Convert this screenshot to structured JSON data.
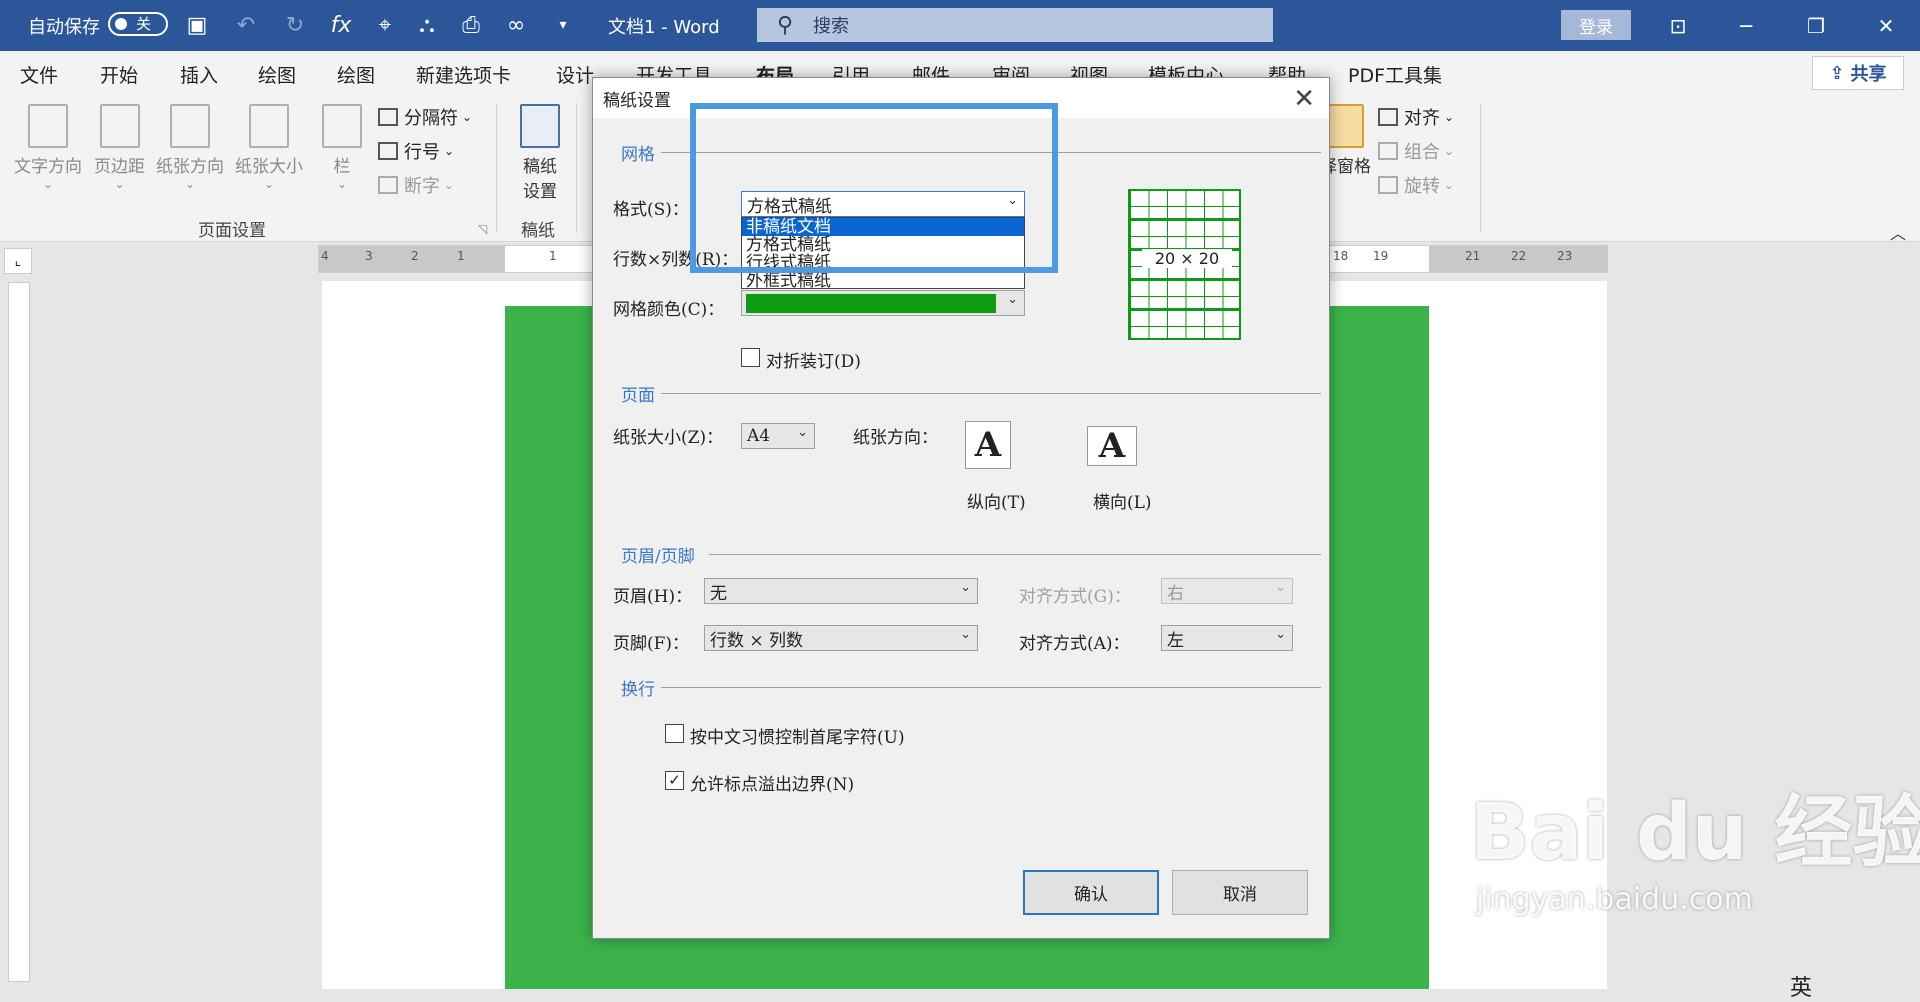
{
  "titlebar": {
    "autosave_label": "自动保存",
    "autosave_state": "关",
    "doc_title": "文档1  -  Word",
    "search_placeholder": "搜索",
    "login": "登录"
  },
  "menu": [
    "文件",
    "开始",
    "插入",
    "绘图",
    "绘图",
    "新建选项卡",
    "设计",
    "开发工具",
    "布局",
    "引用",
    "邮件",
    "审阅",
    "视图",
    "模板中心",
    "帮助",
    "PDF工具集"
  ],
  "share": "共享",
  "ribbon": {
    "text_direction": "文字方向",
    "margins": "页边距",
    "orientation": "纸张方向",
    "size": "纸张大小",
    "columns": "栏",
    "breaks": "分隔符",
    "line_numbers": "行号",
    "hyphenation": "断字",
    "page_setup_group": "页面设置",
    "grid_paper_btn_1": "稿纸",
    "grid_paper_btn_2": "设置",
    "grid_paper_group": "稿纸",
    "selection_pane": "择窗格",
    "align": "对齐",
    "group": "组合",
    "rotate": "旋转"
  },
  "ruler": [
    "4",
    "3",
    "2",
    "1",
    "1",
    "18",
    "19",
    "21",
    "22",
    "23"
  ],
  "dialog": {
    "title": "稿纸设置",
    "sec_grid": "网格",
    "format_label": "格式(S)：",
    "format_value": "方格式稿纸",
    "format_options": [
      "非稿纸文档",
      "方格式稿纸",
      "行线式稿纸",
      "外框式稿纸"
    ],
    "rowcol_label": "行数×列数(R)：",
    "color_label": "网格颜色(C)：",
    "grid_color": "#0c9b12",
    "fold_label": "对折装订(D)",
    "preview_text": "20  ×  20",
    "sec_page": "页面",
    "papersize_label": "纸张大小(Z)：",
    "papersize_value": "A4",
    "orientation_label": "纸张方向：",
    "portrait_label": "纵向(T)",
    "landscape_label": "横向(L)",
    "sec_header": "页眉/页脚",
    "header_label": "页眉(H)：",
    "header_value": "无",
    "header_align_label": "对齐方式(G)：",
    "header_align_value": "右",
    "footer_label": "页脚(F)：",
    "footer_value": "行数  ×  列数",
    "footer_align_label": "对齐方式(A)：",
    "footer_align_value": "左",
    "sec_wrap": "换行",
    "opt_chinese": "按中文习惯控制首尾字符(U)",
    "opt_punct": "允许标点溢出边界(N)",
    "ok": "确认",
    "cancel": "取消"
  },
  "watermark": {
    "brand": "Bai du 经验",
    "url": "jingyan.baidu.com"
  },
  "statusbar": "英"
}
